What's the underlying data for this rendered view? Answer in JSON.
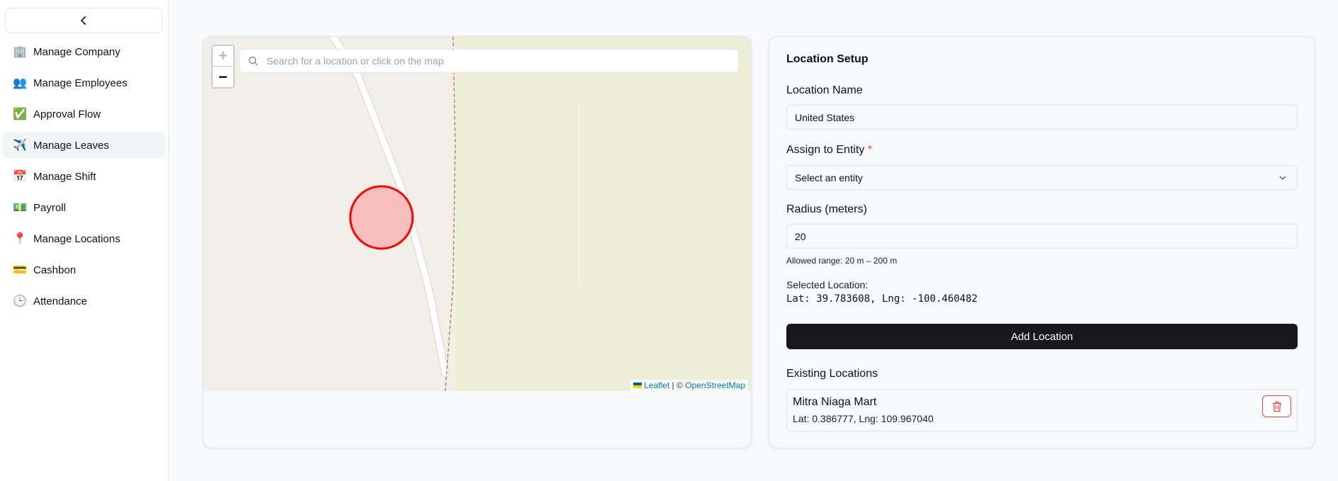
{
  "sidebar": {
    "collapse_icon": "chevron-left-icon",
    "items": [
      {
        "label": "Manage Company",
        "icon": "🏢",
        "active": false
      },
      {
        "label": "Manage Employees",
        "icon": "👥",
        "active": false
      },
      {
        "label": "Approval Flow",
        "icon": "✅",
        "active": false
      },
      {
        "label": "Manage Leaves",
        "icon": "✈️",
        "active": true
      },
      {
        "label": "Manage Shift",
        "icon": "📅",
        "active": false
      },
      {
        "label": "Payroll",
        "icon": "💵",
        "active": false
      },
      {
        "label": "Manage Locations",
        "icon": "📍",
        "active": false
      },
      {
        "label": "Cashbon",
        "icon": "💳",
        "active": false
      },
      {
        "label": "Attendance",
        "icon": "🕒",
        "active": false
      }
    ]
  },
  "map": {
    "zoom_in": "+",
    "zoom_out": "−",
    "search_placeholder": "Search for a location or click on the map",
    "attribution": {
      "leaflet": "Leaflet",
      "separator": " | © ",
      "osm": "OpenStreetMap"
    },
    "circle_color": "#ff0000"
  },
  "setup": {
    "title": "Location Setup",
    "name_label": "Location Name",
    "name_value": "United States",
    "entity_label": "Assign to Entity",
    "required_mark": "*",
    "entity_placeholder": "Select an entity",
    "radius_label": "Radius (meters)",
    "radius_value": "20",
    "radius_hint": "Allowed range: 20 m – 200 m",
    "selected_label": "Selected Location:",
    "selected_coords": "Lat: 39.783608, Lng: -100.460482",
    "add_button": "Add Location",
    "existing_title": "Existing Locations",
    "existing": [
      {
        "name": "Mitra Niaga Mart",
        "coords": "Lat: 0.386777, Lng: 109.967040"
      }
    ]
  }
}
